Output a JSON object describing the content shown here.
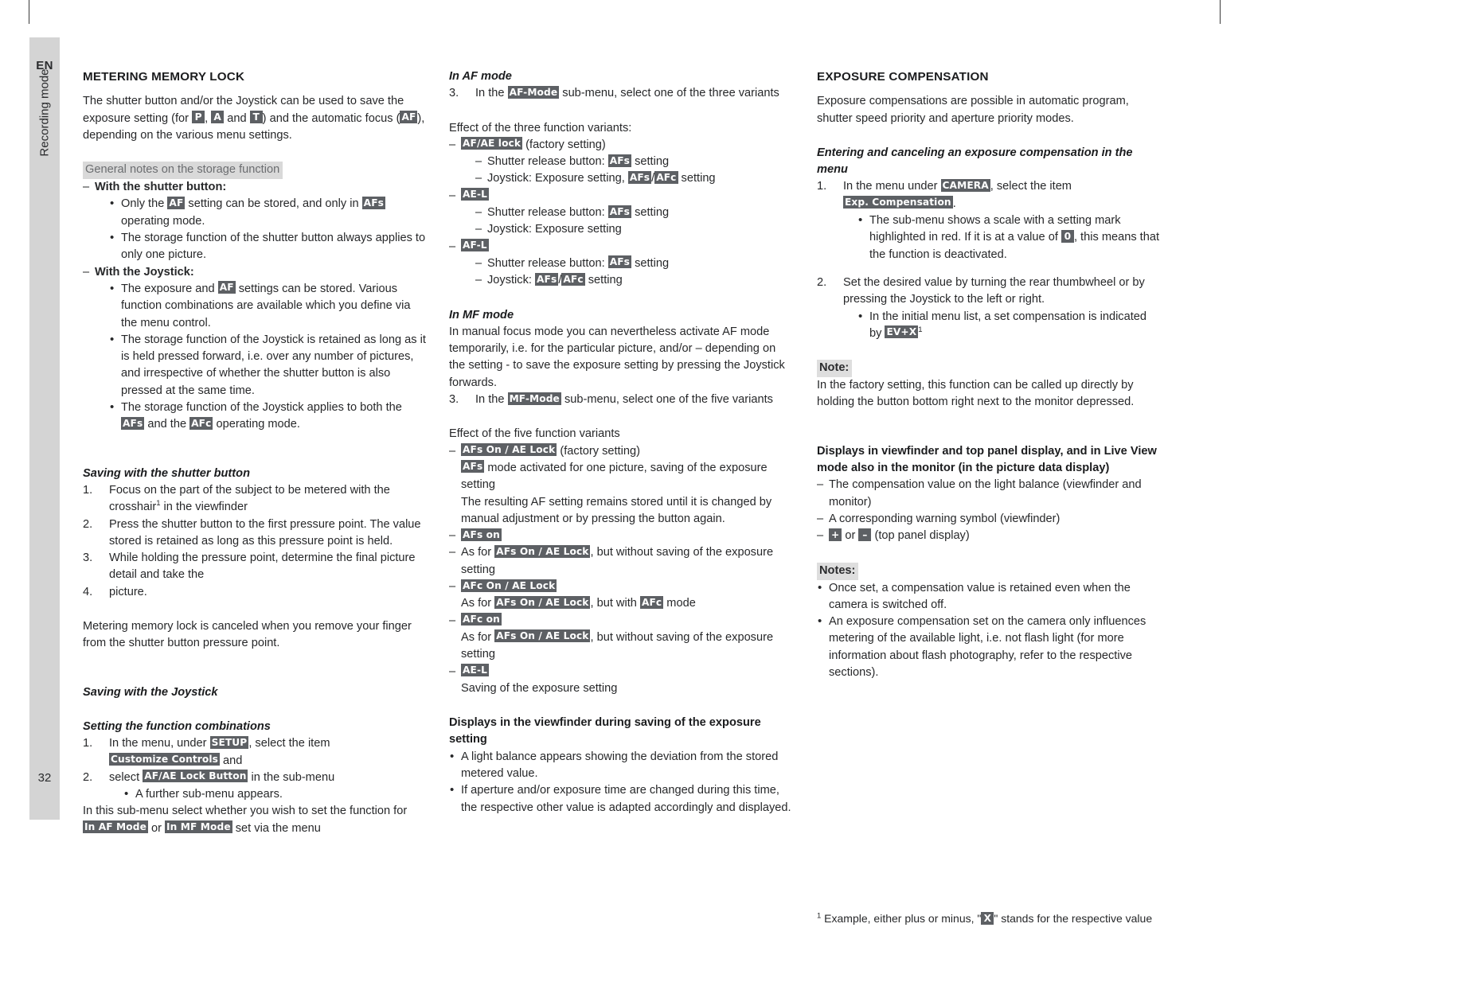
{
  "sidebar": {
    "language": "EN",
    "chapter": "Recording mode",
    "page_number": "32"
  },
  "column1": {
    "heading": "METERING MEMORY LOCK",
    "intro_a": "The shutter button and/or the Joystick can be used to save the exposure setting (for ",
    "tag_P": "P",
    "intro_b": ", ",
    "tag_A": "A",
    "intro_c": " and ",
    "tag_T": "T",
    "intro_d": ") and the automatic focus (",
    "tag_AF": "AF",
    "intro_e": "), depending on the various menu settings.",
    "notes_heading": "General notes on the storage function",
    "shutter_item": "With the shutter button:",
    "shutter_b1_a": "Only the ",
    "shutter_b1_tag1": "AF",
    "shutter_b1_b": " setting can be stored, and only in ",
    "shutter_b1_tag2": "AFs",
    "shutter_b1_c": " operating mode.",
    "shutter_b2": "The storage function of the shutter button always applies to only one picture.",
    "joystick_item": "With the Joystick:",
    "joy_b1_a": "The exposure and ",
    "joy_b1_tag": "AF",
    "joy_b1_b": " settings can be stored. Various function combinations are available which you define via the menu control.",
    "joy_b2": "The storage function of the Joystick is retained as long as it is held pressed forward, i.e. over any number of pictures, and irrespective of whether the shutter button is also pressed at the same time.",
    "joy_b3_a": "The storage function of the Joystick applies to both the ",
    "joy_b3_tag1": "AFs",
    "joy_b3_b": " and the ",
    "joy_b3_tag2": "AFc",
    "joy_b3_c": " operating mode.",
    "saving_shutter_heading": "Saving with the shutter button",
    "ss_1_a": "Focus on the part of the subject to be metered with the crosshair",
    "ss_1_sup": "1",
    "ss_1_b": " in the viewfinder",
    "ss_2": "Press the shutter button to the first pressure point. The value stored is retained as long as this pressure point is held.",
    "ss_3": "While holding the pressure point, determine the final picture detail and take the",
    "ss_4": "picture.",
    "cancel_para": "Metering memory lock is canceled when you remove your finger from the shutter button pressure point.",
    "saving_joystick_heading": "Saving with the Joystick",
    "function_comb_heading": "Setting the function combinations",
    "fc_1_a": "In the menu, under ",
    "fc_1_tag1": "SETUP",
    "fc_1_b": ", select the item ",
    "fc_1_tag2": "Customize Controls",
    "fc_1_c": " and",
    "fc_2_a": "select ",
    "fc_2_tag": "AF/AE Lock Button",
    "fc_2_b": " in the sub-menu",
    "fc_bullet": "A further sub-menu appears.",
    "fc_tail_a": "In this sub-menu select whether you wish to set the function for ",
    "fc_tail_tag1": "In AF Mode",
    "fc_tail_b": " or ",
    "fc_tail_tag2": "In MF Mode",
    "fc_tail_c": " set via the menu"
  },
  "column2": {
    "af_heading": "In AF mode",
    "af_step3_num": "3.",
    "af_step3_a": "In the ",
    "af_step3_tag": "AF-Mode",
    "af_step3_b": " sub-menu, select one of the three variants",
    "effect3_label": "Effect of the three function variants:",
    "v1_tag": "AF/AE lock",
    "v1_suffix": " (factory setting)",
    "v1_s1_a": "Shutter release button: ",
    "v1_s1_tag": "AFs",
    "v1_s1_b": " setting",
    "v1_s2_a": "Joystick: Exposure setting, ",
    "v1_s2_tag1": "AFs",
    "v1_s2_slash": "/",
    "v1_s2_tag2": "AFc",
    "v1_s2_b": " setting",
    "v2_tag": "AE-L",
    "v2_s1_a": "Shutter release button: ",
    "v2_s1_tag": "AFs",
    "v2_s1_b": " setting",
    "v2_s2": "Joystick: Exposure setting",
    "v3_tag": "AF-L",
    "v3_s1_a": "Shutter release button: ",
    "v3_s1_tag": "AFs",
    "v3_s1_b": " setting",
    "v3_s2_a": "Joystick: ",
    "v3_s2_tag1": "AFs",
    "v3_s2_slash": "/",
    "v3_s2_tag2": "AFc",
    "v3_s2_b": " setting",
    "mf_heading": "In MF mode",
    "mf_para": "In manual focus mode you can nevertheless activate AF mode temporarily, i.e. for the particular picture, and/or – depending on the setting - to save the exposure setting by pressing the Joystick forwards.",
    "mf_step3_num": "3.",
    "mf_step3_a": "In the ",
    "mf_step3_tag": "MF-Mode",
    "mf_step3_b": " sub-menu, select one of the five variants",
    "effect5_label": "Effect of the five function variants",
    "m1_tag": "AFs On / AE Lock",
    "m1_suffix": " (factory setting)",
    "m1_l2_tag": "AFs",
    "m1_l2_text": " mode activated for one picture, saving of the exposure setting",
    "m1_l3": "The resulting AF setting remains stored until it is changed by manual adjustment or by pressing the button again.",
    "m2_tag": "AFs on",
    "m3_a": "As for ",
    "m3_tag": "AFs On / AE Lock",
    "m3_b": ", but without saving of the exposure setting",
    "m4_tag": "AFc On / AE Lock",
    "m4_l2_a": "As for ",
    "m4_l2_tag1": "AFs On / AE Lock",
    "m4_l2_b": ", but with ",
    "m4_l2_tag2": "AFc",
    "m4_l2_c": " mode",
    "m5_tag": "AFc on",
    "m5_l2_a": "As for ",
    "m5_l2_tag": "AFs On / AE Lock",
    "m5_l2_b": ", but without saving of the exposure setting",
    "m6_tag": "AE-L",
    "m6_l2": "Saving of the exposure setting",
    "displays_heading": "Displays in the viewfinder during saving of the exposure setting",
    "disp_b1": "A light balance appears showing the deviation from the stored metered value.",
    "disp_b2": "If aperture and/or exposure time are changed during this time, the respective other value is adapted accordingly and displayed."
  },
  "column3": {
    "heading": "EXPOSURE COMPENSATION",
    "intro": "Exposure compensations are possible in automatic program, shutter speed priority and aperture priority modes.",
    "entering_heading": "Entering and canceling an exposure compensation in the menu",
    "e1_a": "In the menu under ",
    "e1_tag1": "CAMERA",
    "e1_b": ", select the item ",
    "e1_tag2": "Exp. Compensation",
    "e1_c": ".",
    "e1_bullet_a": "The sub-menu shows a scale with a setting mark highlighted in red. If it is at a value of ",
    "e1_bullet_tag": "0",
    "e1_bullet_b": ", this means that the function is deactivated.",
    "e2": "Set the desired value by turning the rear thumbwheel or by pressing the Joystick to the left or right.",
    "e2_bullet_a": "In the initial menu list, a set compensation is indicated by ",
    "e2_bullet_tag": "EV+X",
    "e2_bullet_sup": "1",
    "note_label": "Note:",
    "note_text": "In the factory setting, this function can be called up directly by holding the button bottom right next to the monitor depressed.",
    "displays_heading": "Displays in viewfinder and top panel display, and in Live View mode also in the monitor (in the picture data display)",
    "d1": "The compensation value on the light balance (viewfinder and monitor)",
    "d2": "A corresponding warning symbol (viewfinder)",
    "d3_tag1": "+",
    "d3_mid": " or ",
    "d3_tag2": "–",
    "d3_b": " (top panel display)",
    "notes_label": "Notes:",
    "n1": "Once set, a compensation value is retained even when the camera is switched off.",
    "n2": "An exposure compensation set on the camera only influences metering of the available light, i.e. not flash light (for more information about flash photography, refer to the respective sections).",
    "footnote_sup": "1",
    "footnote_a": " Example, either plus or minus, \"",
    "footnote_tag": "X",
    "footnote_b": "\" stands for the respective value"
  },
  "colors": {
    "tag_background": "#5d6064",
    "grey_heading_background": "#d9d9d9",
    "sidebar_background": "#d4d4d4",
    "text": "#27282a"
  }
}
